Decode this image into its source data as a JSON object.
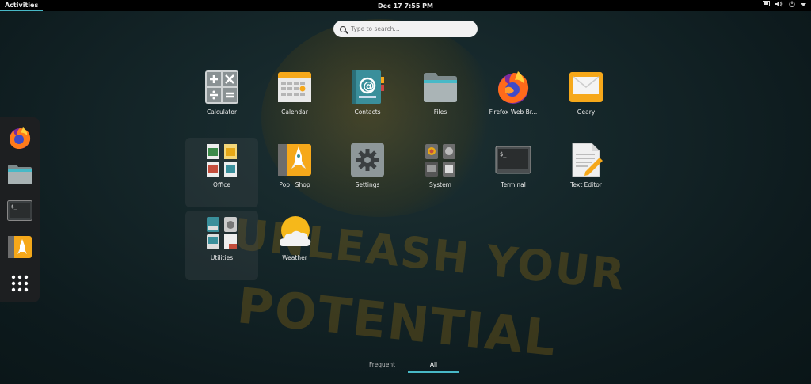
{
  "topbar": {
    "activities": "Activities",
    "clock": "Dec 17   7:55 PM",
    "tray": {
      "screen_icon": "screen-icon",
      "volume_icon": "volume-icon",
      "power_icon": "power-icon",
      "menu_icon": "chevron-down-icon"
    }
  },
  "wallpaper": {
    "slogan_line1": "UNLEASH YOUR",
    "slogan_line2": "POTENTIAL"
  },
  "search": {
    "placeholder": "Type to search..."
  },
  "dash": {
    "items": [
      {
        "name": "Firefox Web Browser",
        "icon": "firefox-icon"
      },
      {
        "name": "Files",
        "icon": "folder-icon"
      },
      {
        "name": "Terminal",
        "icon": "terminal-icon"
      },
      {
        "name": "Pop!_Shop",
        "icon": "shop-icon"
      },
      {
        "name": "Show Applications",
        "icon": "app-grid-icon"
      }
    ]
  },
  "apps": [
    {
      "label": "Calculator",
      "icon": "calculator-icon"
    },
    {
      "label": "Calendar",
      "icon": "calendar-icon"
    },
    {
      "label": "Contacts",
      "icon": "contacts-icon"
    },
    {
      "label": "Files",
      "icon": "folder-icon"
    },
    {
      "label": "Firefox Web Br...",
      "icon": "firefox-icon"
    },
    {
      "label": "Geary",
      "icon": "mail-icon"
    },
    {
      "label": "Office",
      "icon": "office-folder-icon"
    },
    {
      "label": "Pop!_Shop",
      "icon": "shop-icon"
    },
    {
      "label": "Settings",
      "icon": "gear-icon"
    },
    {
      "label": "System",
      "icon": "system-folder-icon"
    },
    {
      "label": "Terminal",
      "icon": "terminal-icon"
    },
    {
      "label": "Text Editor",
      "icon": "text-editor-icon"
    },
    {
      "label": "Utilities",
      "icon": "utilities-folder-icon"
    },
    {
      "label": "Weather",
      "icon": "weather-icon"
    }
  ],
  "tabs": [
    {
      "label": "Frequent",
      "active": false
    },
    {
      "label": "All",
      "active": true
    }
  ],
  "colors": {
    "accent": "#48b9c7",
    "panel": "#000000",
    "dash": "#1e2022",
    "folder": "#9aa4a6",
    "orange": "#f6a81a"
  }
}
